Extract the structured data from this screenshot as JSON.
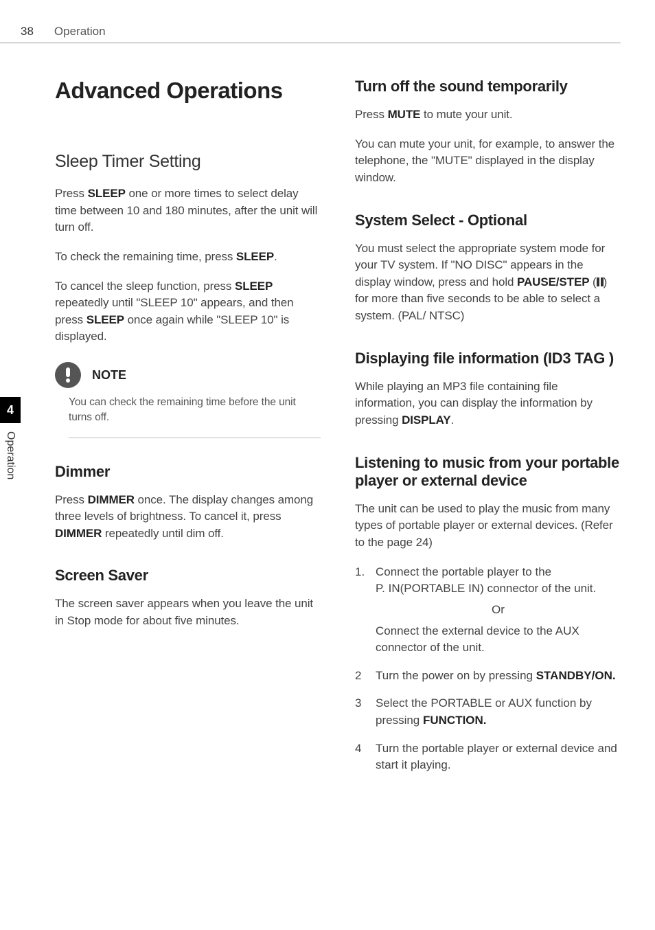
{
  "page_number": "38",
  "header_title": "Operation",
  "side_tab": {
    "number": "4",
    "label": "Operation"
  },
  "left": {
    "h1": "Advanced Operations",
    "sleep": {
      "title": "Sleep Timer Setting",
      "p1_a": "Press ",
      "p1_b": "SLEEP",
      "p1_c": " one or more times to select delay time between 10 and 180 minutes, after the unit will turn off.",
      "p2_a": "To check the remaining time, press ",
      "p2_b": "SLEEP",
      "p2_c": ".",
      "p3_a": "To cancel the sleep function, press ",
      "p3_b": "SLEEP",
      "p3_c": " repeatedly until \"SLEEP 10\" appears, and then press ",
      "p3_d": "SLEEP",
      "p3_e": " once again while \"SLEEP 10\" is displayed."
    },
    "note": {
      "label": "NOTE",
      "text": "You can check the remaining time before the unit turns off."
    },
    "dimmer": {
      "title": "Dimmer",
      "p1_a": "Press ",
      "p1_b": "DIMMER",
      "p1_c": " once. The display changes among three levels of brightness. To cancel it, press ",
      "p1_d": "DIMMER",
      "p1_e": " repeatedly until dim off."
    },
    "screensaver": {
      "title": "Screen Saver",
      "p1": "The screen saver appears when you leave the unit in Stop mode for about five minutes."
    }
  },
  "right": {
    "mute": {
      "title": "Turn off the sound temporarily",
      "p1_a": "Press ",
      "p1_b": "MUTE",
      "p1_c": " to mute your unit.",
      "p2": "You can mute your unit, for example, to answer the telephone, the \"MUTE\" displayed  in the display window."
    },
    "system": {
      "title": "System Select - Optional",
      "p1_a": "You must select the appropriate system mode for your TV system. If  \"NO DISC\" appears in the display window, press and hold ",
      "p1_b": "PAUSE/STEP",
      "p1_c": " (",
      "p1_d": ") for more than five seconds to be able to select a system. (PAL/ NTSC)"
    },
    "id3": {
      "title": "Displaying file information (ID3 TAG )",
      "p1_a": "While playing an MP3 file containing file information, you can display the information by pressing ",
      "p1_b": "DISPLAY",
      "p1_c": "."
    },
    "portable": {
      "title": "Listening to music from your portable player or external device",
      "p1": "The unit can be used to play the music from many types of portable player or external devices. (Refer to the page 24)",
      "li1": {
        "n": "1.",
        "a": "Connect the portable player to the ",
        "b": "P. IN(PORTABLE IN) connector of the unit.",
        "or": "Or",
        "c": "Connect the external device to the AUX connector of the unit."
      },
      "li2": {
        "n": "2",
        "a": "Turn the power on by pressing ",
        "b": "STANDBY/ON."
      },
      "li3": {
        "n": "3",
        "a": "Select the PORTABLE or AUX function by pressing ",
        "b": "FUNCTION."
      },
      "li4": {
        "n": "4",
        "a": "Turn the portable player or external device and start it playing."
      }
    }
  }
}
